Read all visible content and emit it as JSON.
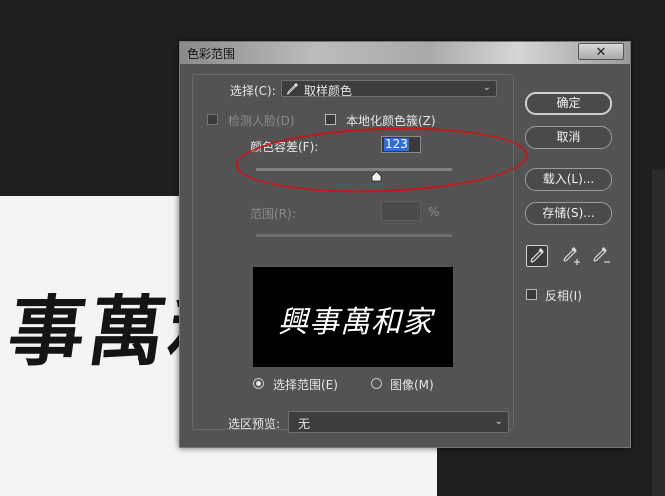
{
  "dialog": {
    "title": "色彩范围",
    "close_glyph": "✕"
  },
  "select": {
    "label": "选择(C):",
    "value": "取样颜色",
    "icon": "eyedropper-icon"
  },
  "detect_faces": {
    "label": "检测人脸(D)",
    "checked": false,
    "enabled": false
  },
  "localized_clusters": {
    "label": "本地化颜色簇(Z)",
    "checked": false
  },
  "fuzziness": {
    "label": "颜色容差(F):",
    "value": "123",
    "slider_fraction": 0.615
  },
  "range": {
    "label": "范围(R):",
    "value": "",
    "unit": "%",
    "enabled": false
  },
  "preview": {
    "text": "興事萬和家"
  },
  "view_mode": {
    "options": [
      {
        "label": "选择范围(E)",
        "selected": true
      },
      {
        "label": "图像(M)",
        "selected": false
      }
    ]
  },
  "selection_preview": {
    "label": "选区预览:",
    "value": "无"
  },
  "buttons": {
    "ok": "确定",
    "cancel": "取消",
    "load": "载入(L)...",
    "save": "存储(S)..."
  },
  "eyedroppers": [
    "eyedropper-icon",
    "eyedropper-plus-icon",
    "eyedropper-minus-icon"
  ],
  "invert": {
    "label": "反相(I)",
    "checked": false
  },
  "background_canvas": {
    "text": "事萬和"
  },
  "colors": {
    "dialog_bg": "#535353",
    "highlight": "#2d6fd8",
    "annotation": "#c9141c"
  }
}
